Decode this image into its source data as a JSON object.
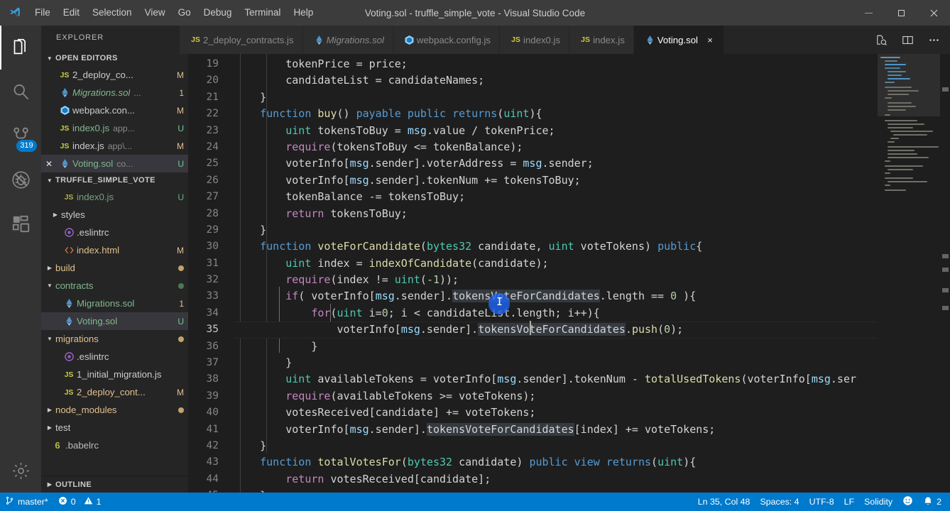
{
  "titlebar": {
    "logo_icon": "vscode-logo",
    "menus": [
      "File",
      "Edit",
      "Selection",
      "View",
      "Go",
      "Debug",
      "Terminal",
      "Help"
    ],
    "window_title": "Voting.sol - truffle_simple_vote - Visual Studio Code",
    "controls": [
      "minimize-icon",
      "maximize-icon",
      "close-icon"
    ]
  },
  "activitybar": {
    "items": [
      {
        "name": "explorer",
        "icon": "files-icon",
        "active": true,
        "badge": ""
      },
      {
        "name": "search",
        "icon": "search-icon",
        "active": false,
        "badge": ""
      },
      {
        "name": "source-control",
        "icon": "source-control-icon",
        "active": false,
        "badge": "319"
      },
      {
        "name": "debug",
        "icon": "debug-no-icon",
        "active": false,
        "badge": ""
      },
      {
        "name": "extensions",
        "icon": "extensions-icon",
        "active": false,
        "badge": ""
      }
    ],
    "manage": {
      "name": "settings",
      "icon": "gear-icon"
    }
  },
  "sidebar": {
    "title": "EXPLORER",
    "open_editors": {
      "label": "OPEN EDITORS",
      "items": [
        {
          "name": "2_deploy_co...",
          "icon": "js-icon",
          "detail": "",
          "badge": "M",
          "badge_class": "b-M",
          "closebox": false,
          "selected": false,
          "italic": false,
          "dim": false
        },
        {
          "name": "Migrations.sol",
          "icon": "solidity-icon",
          "detail": "...",
          "badge": "1",
          "badge_class": "b-1",
          "closebox": false,
          "selected": false,
          "italic": true,
          "dim": true
        },
        {
          "name": "webpack.con...",
          "icon": "webpack-icon",
          "detail": "",
          "badge": "M",
          "badge_class": "b-M",
          "closebox": false,
          "selected": false,
          "italic": false,
          "dim": false
        },
        {
          "name": "index0.js",
          "icon": "js-icon",
          "detail": "app...",
          "badge": "U",
          "badge_class": "b-U",
          "closebox": false,
          "selected": false,
          "italic": false,
          "dim": true
        },
        {
          "name": "index.js",
          "icon": "js-icon",
          "detail": "app\\...",
          "badge": "M",
          "badge_class": "b-M",
          "closebox": false,
          "selected": false,
          "italic": false,
          "dim": false
        },
        {
          "name": "Voting.sol",
          "icon": "solidity-icon",
          "detail": "co...",
          "badge": "U",
          "badge_class": "b-U",
          "closebox": true,
          "selected": true,
          "italic": false,
          "dim": true
        }
      ]
    },
    "workspace": {
      "label": "TRUFFLE_SIMPLE_VOTE",
      "items": [
        {
          "name": "index0.js",
          "icon": "js-icon",
          "indent": 2,
          "arrow": "",
          "badge": "U",
          "badge_class": "b-U",
          "color": "#73c991",
          "dot": ""
        },
        {
          "name": "styles",
          "icon": "",
          "indent": 1,
          "arrow": "collapsed",
          "badge": "",
          "badge_class": "",
          "color": "#cccccc",
          "dot": ""
        },
        {
          "name": ".eslintrc",
          "icon": "eslint-icon",
          "indent": 2,
          "arrow": "",
          "badge": "",
          "badge_class": "",
          "color": "#cccccc",
          "dot": ""
        },
        {
          "name": "index.html",
          "icon": "html-icon",
          "indent": 2,
          "arrow": "",
          "badge": "M",
          "badge_class": "b-M",
          "color": "#e2c08d",
          "dot": ""
        },
        {
          "name": "build",
          "icon": "",
          "indent": 0,
          "arrow": "collapsed",
          "badge": "",
          "badge_class": "",
          "color": "#e2c08d",
          "dot": "amber"
        },
        {
          "name": "contracts",
          "icon": "",
          "indent": 0,
          "arrow": "expanded",
          "badge": "",
          "badge_class": "",
          "color": "#81b88b",
          "dot": "green"
        },
        {
          "name": "Migrations.sol",
          "icon": "solidity-icon",
          "indent": 2,
          "arrow": "",
          "badge": "1",
          "badge_class": "b-1",
          "color": "#81b88b",
          "dot": ""
        },
        {
          "name": "Voting.sol",
          "icon": "solidity-icon",
          "indent": 2,
          "arrow": "",
          "badge": "U",
          "badge_class": "b-U",
          "color": "#73c991",
          "dot": "",
          "selected": true
        },
        {
          "name": "migrations",
          "icon": "",
          "indent": 0,
          "arrow": "expanded",
          "badge": "",
          "badge_class": "",
          "color": "#e2c08d",
          "dot": "amber"
        },
        {
          "name": ".eslintrc",
          "icon": "eslint-icon",
          "indent": 2,
          "arrow": "",
          "badge": "",
          "badge_class": "",
          "color": "#cccccc",
          "dot": ""
        },
        {
          "name": "1_initial_migration.js",
          "icon": "js-icon",
          "indent": 2,
          "arrow": "",
          "badge": "",
          "badge_class": "",
          "color": "#cccccc",
          "dot": ""
        },
        {
          "name": "2_deploy_cont...",
          "icon": "js-icon",
          "indent": 2,
          "arrow": "",
          "badge": "M",
          "badge_class": "b-M",
          "color": "#e2c08d",
          "dot": ""
        },
        {
          "name": "node_modules",
          "icon": "",
          "indent": 0,
          "arrow": "collapsed",
          "badge": "",
          "badge_class": "",
          "color": "#e2c08d",
          "dot": "amber"
        },
        {
          "name": "test",
          "icon": "",
          "indent": 0,
          "arrow": "collapsed",
          "badge": "",
          "badge_class": "",
          "color": "#cccccc",
          "dot": ""
        },
        {
          "name": ".babelrc",
          "icon": "babel-icon",
          "indent": 1,
          "arrow": "",
          "badge": "",
          "badge_class": "",
          "color": "#cccccc",
          "dot": ""
        }
      ]
    },
    "outline": {
      "label": "OUTLINE"
    }
  },
  "tabs": {
    "items": [
      {
        "label": "2_deploy_contracts.js",
        "icon": "js-icon",
        "active": false,
        "italic": false,
        "dirty": false,
        "partial": true
      },
      {
        "label": "Migrations.sol",
        "icon": "solidity-icon",
        "active": false,
        "italic": true,
        "dirty": false,
        "partial": false
      },
      {
        "label": "webpack.config.js",
        "icon": "webpack-icon",
        "active": false,
        "italic": false,
        "dirty": false,
        "partial": false
      },
      {
        "label": "index0.js",
        "icon": "js-icon",
        "active": false,
        "italic": false,
        "dirty": false,
        "partial": false
      },
      {
        "label": "index.js",
        "icon": "js-icon",
        "active": false,
        "italic": false,
        "dirty": false,
        "partial": false
      },
      {
        "label": "Voting.sol",
        "icon": "solidity-icon",
        "active": true,
        "italic": false,
        "dirty": false,
        "partial": false,
        "close": "×"
      }
    ],
    "actions": [
      {
        "name": "open-changes-icon"
      },
      {
        "name": "split-editor-icon"
      },
      {
        "name": "more-actions-icon"
      }
    ]
  },
  "editor": {
    "language": "Solidity",
    "first_line": 19,
    "cursor_line": 35,
    "lines": [
      {
        "n": 19,
        "text": "        tokenPrice = price;"
      },
      {
        "n": 20,
        "text": "        candidateList = candidateNames;"
      },
      {
        "n": 21,
        "text": "    }"
      },
      {
        "n": 22,
        "text": "    function buy() payable public returns(uint){"
      },
      {
        "n": 23,
        "text": "        uint tokensToBuy = msg.value / tokenPrice;"
      },
      {
        "n": 24,
        "text": "        require(tokensToBuy <= tokenBalance);"
      },
      {
        "n": 25,
        "text": "        voterInfo[msg.sender].voterAddress = msg.sender;"
      },
      {
        "n": 26,
        "text": "        voterInfo[msg.sender].tokenNum += tokensToBuy;"
      },
      {
        "n": 27,
        "text": "        tokenBalance -= tokensToBuy;"
      },
      {
        "n": 28,
        "text": "        return tokensToBuy;"
      },
      {
        "n": 29,
        "text": "    }"
      },
      {
        "n": 30,
        "text": "    function voteForCandidate(bytes32 candidate, uint voteTokens) public{"
      },
      {
        "n": 31,
        "text": "        uint index = indexOfCandidate(candidate);"
      },
      {
        "n": 32,
        "text": "        require(index != uint(-1));"
      },
      {
        "n": 33,
        "text": "        if( voterInfo[msg.sender].tokensVoteForCandidates.length == 0 ){"
      },
      {
        "n": 34,
        "text": "            for(uint i=0; i < candidateList.length; i++){"
      },
      {
        "n": 35,
        "text": "                voterInfo[msg.sender].tokensVoteForCandidates.push(0);"
      },
      {
        "n": 36,
        "text": "            }"
      },
      {
        "n": 37,
        "text": "        }"
      },
      {
        "n": 38,
        "text": "        uint availableTokens = voterInfo[msg.sender].tokenNum - totalUsedTokens(voterInfo[msg.ser"
      },
      {
        "n": 39,
        "text": "        require(availableTokens >= voteTokens);"
      },
      {
        "n": 40,
        "text": "        votesReceived[candidate] += voteTokens;"
      },
      {
        "n": 41,
        "text": "        voterInfo[msg.sender].tokensVoteForCandidates[index] += voteTokens;"
      },
      {
        "n": 42,
        "text": "    }"
      },
      {
        "n": 43,
        "text": "    function totalVotesFor(bytes32 candidate) public view returns(uint){"
      },
      {
        "n": 44,
        "text": "        return votesReceived[candidate];"
      },
      {
        "n": 45,
        "text": "    }"
      }
    ],
    "highlighted_word": "tokensVoteForCandidates"
  },
  "statusbar": {
    "left": [
      {
        "name": "branch",
        "icon": "git-branch-icon",
        "text": "master*"
      },
      {
        "name": "problems",
        "icon": "error-icon",
        "text": "0",
        "icon2": "warning-icon",
        "text2": "1"
      }
    ],
    "right": [
      {
        "name": "cursor-position",
        "text": "Ln 35, Col 48"
      },
      {
        "name": "indentation",
        "text": "Spaces: 4"
      },
      {
        "name": "encoding",
        "text": "UTF-8"
      },
      {
        "name": "eol",
        "text": "LF"
      },
      {
        "name": "language-mode",
        "text": "Solidity"
      },
      {
        "name": "feedback",
        "icon": "smiley-icon",
        "text": ""
      },
      {
        "name": "notifications",
        "icon": "bell-icon",
        "text": "2"
      }
    ]
  },
  "colors": {
    "accent": "#007acc",
    "titlebar_bg": "#3c3c3c",
    "activitybar_bg": "#333333",
    "sidebar_bg": "#252526",
    "editor_bg": "#1e1e1e",
    "tab_inactive_bg": "#2d2d2d",
    "selected_row_bg": "#37373d"
  }
}
